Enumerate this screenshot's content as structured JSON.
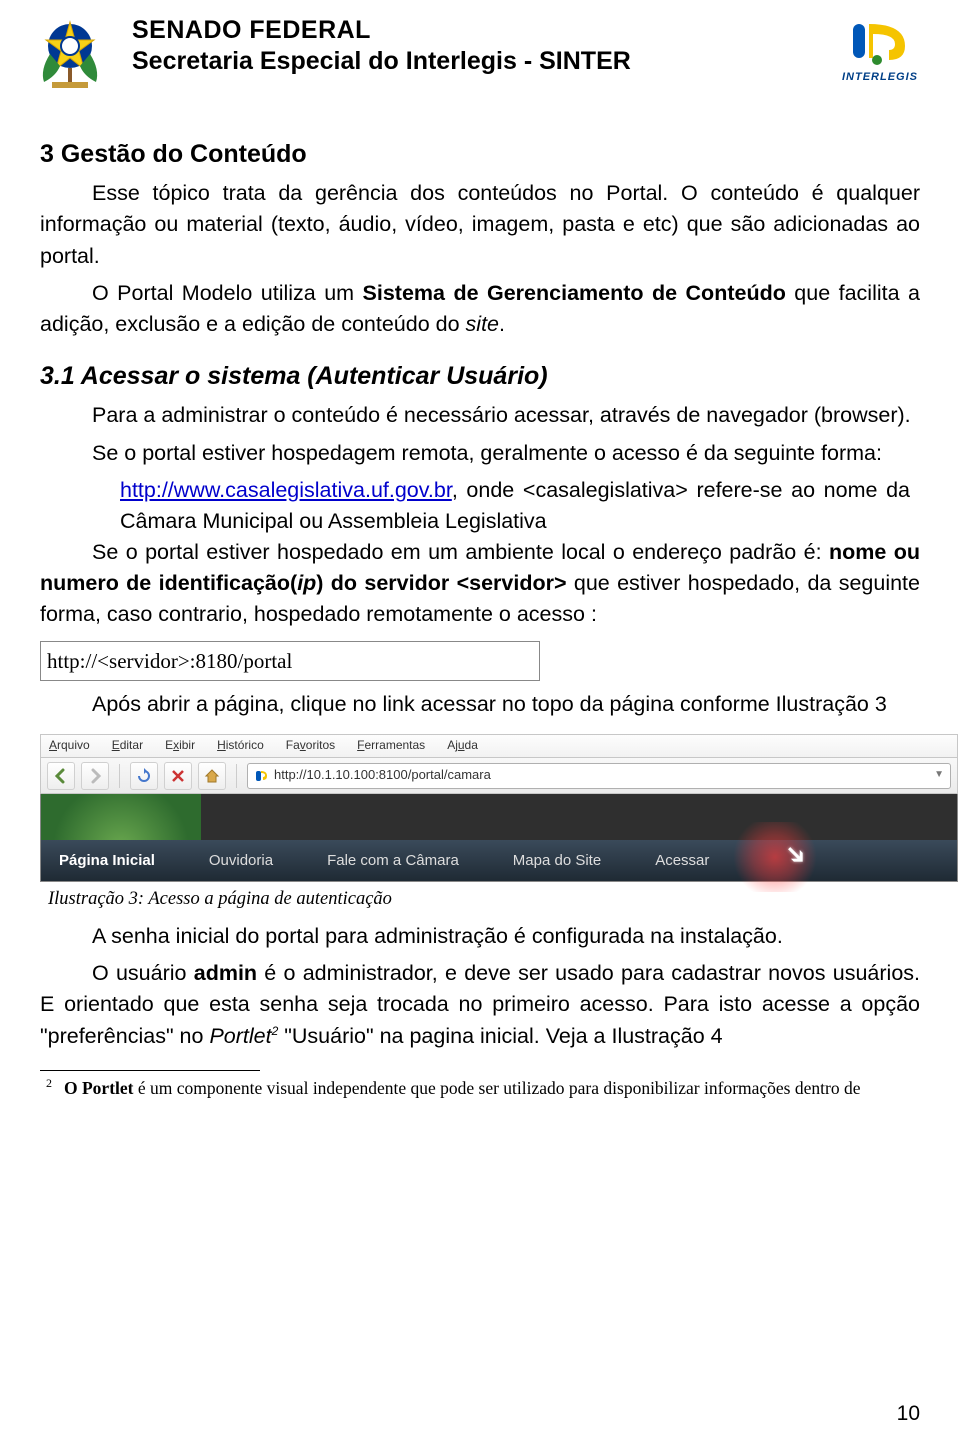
{
  "header": {
    "line1": "SENADO FEDERAL",
    "line2": "Secretaria Especial do Interlegis - SINTER",
    "logo_right_text": "INTERLEGIS"
  },
  "body": {
    "h3": "3 Gestão do Conteúdo",
    "p1a": "Esse tópico trata da gerência dos conteúdos no Portal. O conteúdo é qualquer informação ou material (texto, áudio, vídeo, imagem, pasta e etc) que são adicionadas ao portal.",
    "p2_pre": "O Portal Modelo utiliza um ",
    "p2_bold": "Sistema de Gerenciamento de Conteúdo",
    "p2_post": " que facilita a adição, exclusão e a edição de conteúdo do ",
    "p2_site": "site",
    "p2_dot": ".",
    "h31": "3.1 Acessar o sistema (Autenticar Usuário)",
    "p3": "Para a administrar o conteúdo é necessário acessar, através de navegador (browser).",
    "p4": "Se o portal estiver hospedagem remota, geralmente o acesso é da seguinte forma:",
    "url1": "http://www.casalegislativa.uf.gov.br",
    "url1_rest": ", onde <casalegislativa> refere-se ao nome da Câmara Municipal ou Assembleia Legislativa",
    "p5_pre": "Se o portal estiver hospedado em um ambiente local o endereço padrão é: ",
    "p5_nome": "nome ou numero de identificação(",
    "p5_ip": "ip",
    "p5_mid": ") do servidor <servidor>",
    "p5_post": " que estiver hospedado, da seguinte forma, caso contrario, hospedado remotamente o acesso :",
    "url_box": "http://<servidor>:8180/portal",
    "p6": "Após abrir a página, clique no link acessar no topo da página conforme Ilustração 3",
    "caption3": "Ilustração 3: Acesso a página de autenticação",
    "p7": "A senha inicial do portal para administração é configurada na instalação.",
    "p8_pre": "O usuário ",
    "p8_admin": "admin",
    "p8_post": " é o administrador, e deve ser usado para cadastrar novos usuários. E orientado que esta senha seja trocada no primeiro acesso. Para isto acesse a opção \"preferências\" no ",
    "p8_portlet": "Portlet",
    "p8_last": " \"Usuário\" na pagina inicial. Veja a Ilustração 4"
  },
  "ill3": {
    "menu": [
      "Arquivo",
      "Editar",
      "Exibir",
      "Histórico",
      "Favoritos",
      "Ferramentas",
      "Ajuda"
    ],
    "addr": "http://10.1.10.100:8100/portal/camara",
    "nav": [
      "Página Inicial",
      "Ouvidoria",
      "Fale com a Câmara",
      "Mapa do Site",
      "Acessar"
    ]
  },
  "footnote": {
    "num": "2",
    "text_bold": "O Portlet",
    "text_rest": " é um componente visual independente que pode ser utilizado para disponibilizar informações dentro de"
  },
  "page_number": "10"
}
